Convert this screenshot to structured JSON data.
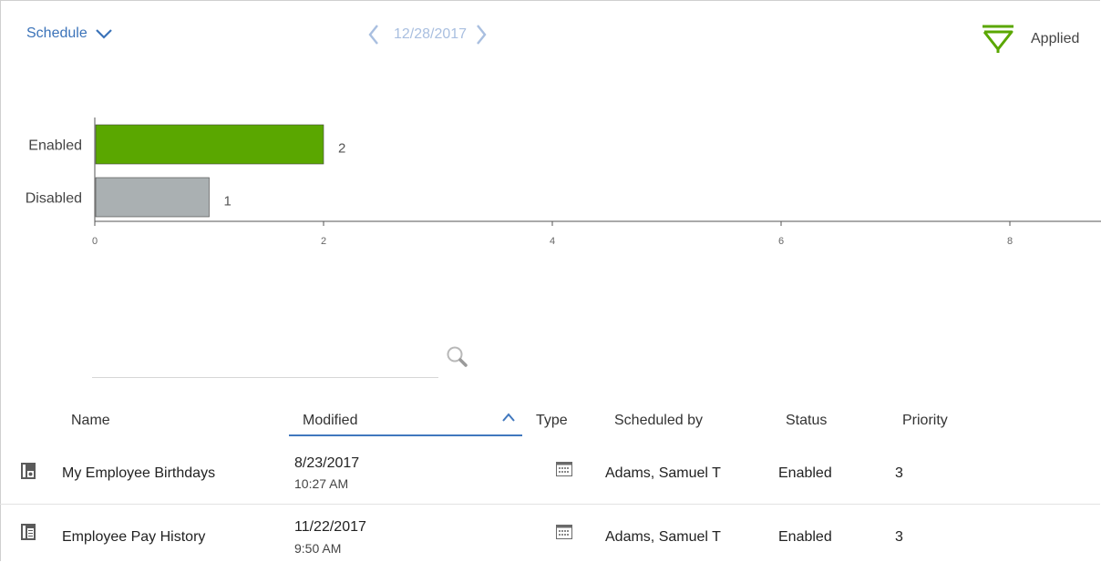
{
  "header": {
    "view_label": "Schedule",
    "date": "12/28/2017",
    "filter_label": "Applied",
    "colors": {
      "link": "#3b73b9",
      "date": "#a9bfe0",
      "filter": "#5aa700"
    }
  },
  "chart_data": {
    "type": "bar",
    "orientation": "horizontal",
    "categories": [
      "Enabled",
      "Disabled"
    ],
    "values": [
      2,
      1
    ],
    "data_labels": [
      "2",
      "1"
    ],
    "colors": [
      "#5aa700",
      "#aab0b2"
    ],
    "x_ticks": [
      "0",
      "2",
      "4",
      "6",
      "8"
    ],
    "xlim": [
      0,
      8.7
    ],
    "grid": false
  },
  "search": {
    "placeholder": "",
    "value": ""
  },
  "table": {
    "columns": {
      "name": "Name",
      "modified": "Modified",
      "type": "Type",
      "scheduled_by": "Scheduled by",
      "status": "Status",
      "priority": "Priority"
    },
    "sorted_by": "modified",
    "sort_direction": "ascending",
    "rows": [
      {
        "icon": "report-view-icon",
        "name": "My Employee Birthdays",
        "date": "8/23/2017",
        "time": "10:27 AM",
        "type_icon": "calendar-icon",
        "scheduled_by": "Adams, Samuel T",
        "status": "Enabled",
        "priority": "3"
      },
      {
        "icon": "report-icon",
        "name": "Employee Pay History",
        "date": "11/22/2017",
        "time": "9:50 AM",
        "type_icon": "calendar-icon",
        "scheduled_by": "Adams, Samuel T",
        "status": "Enabled",
        "priority": "3"
      }
    ]
  }
}
